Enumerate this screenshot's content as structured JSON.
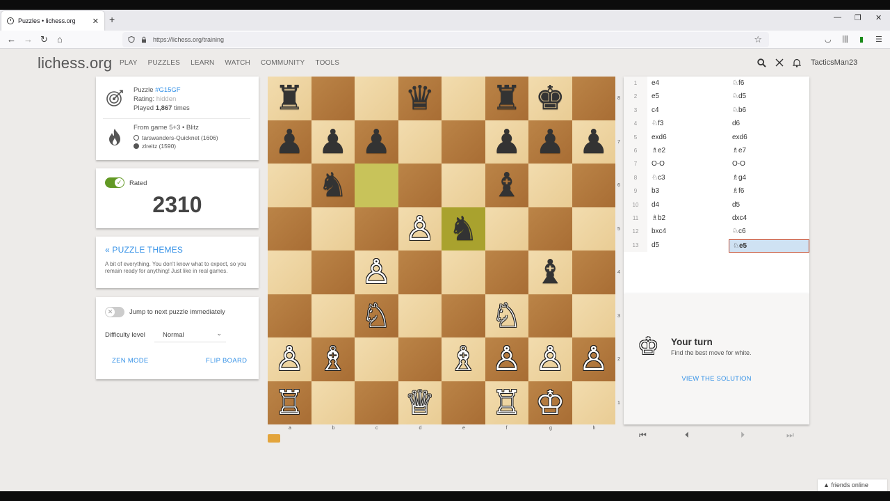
{
  "browser": {
    "tab_title": "Puzzles • lichess.org",
    "tab_close": "✕",
    "new_tab": "+",
    "url": "https://lichess.org/training",
    "win_min": "—",
    "win_max": "❐",
    "win_close": "✕"
  },
  "site": {
    "logo": "lichess.org",
    "nav": [
      "PLAY",
      "PUZZLES",
      "LEARN",
      "WATCH",
      "COMMUNITY",
      "TOOLS"
    ],
    "username": "TacticsMan23"
  },
  "puzzle": {
    "label": "Puzzle ",
    "id": "#G15GF",
    "rating_label": "Rating: ",
    "rating_value": "hidden",
    "played_prefix": "Played ",
    "played_count": "1,867",
    "played_suffix": " times",
    "from_game": "From game 5+3 • Blitz",
    "white_player": "tarswanders-Quicknet (1606)",
    "black_player": "zlreitz (1590)"
  },
  "rating_box": {
    "label": "Rated",
    "value": "2310"
  },
  "themes": {
    "title": "« PUZZLE THEMES",
    "description": "A bit of everything. You don't know what to expect, so you remain ready for anything! Just like in real games."
  },
  "settings": {
    "jump_label": "Jump to next puzzle immediately",
    "difficulty_label": "Difficulty level",
    "difficulty_value": "Normal",
    "zen_mode": "ZEN MODE",
    "flip_board": "FLIP BOARD"
  },
  "board": {
    "ranks": [
      "8",
      "7",
      "6",
      "5",
      "4",
      "3",
      "2",
      "1"
    ],
    "files": [
      "a",
      "b",
      "c",
      "d",
      "e",
      "f",
      "g",
      "h"
    ],
    "highlight_squares": [
      "c6",
      "e5"
    ],
    "pieces": [
      {
        "sq": "a8",
        "glyph": "♜",
        "color": "b",
        "name": "black-rook"
      },
      {
        "sq": "d8",
        "glyph": "♛",
        "color": "b",
        "name": "black-queen"
      },
      {
        "sq": "f8",
        "glyph": "♜",
        "color": "b",
        "name": "black-rook"
      },
      {
        "sq": "g8",
        "glyph": "♚",
        "color": "b",
        "name": "black-king"
      },
      {
        "sq": "a7",
        "glyph": "♟",
        "color": "b",
        "name": "black-pawn"
      },
      {
        "sq": "b7",
        "glyph": "♟",
        "color": "b",
        "name": "black-pawn"
      },
      {
        "sq": "c7",
        "glyph": "♟",
        "color": "b",
        "name": "black-pawn"
      },
      {
        "sq": "f7",
        "glyph": "♟",
        "color": "b",
        "name": "black-pawn"
      },
      {
        "sq": "g7",
        "glyph": "♟",
        "color": "b",
        "name": "black-pawn"
      },
      {
        "sq": "h7",
        "glyph": "♟",
        "color": "b",
        "name": "black-pawn"
      },
      {
        "sq": "b6",
        "glyph": "♞",
        "color": "b",
        "name": "black-knight"
      },
      {
        "sq": "f6",
        "glyph": "♝",
        "color": "b",
        "name": "black-bishop"
      },
      {
        "sq": "d5",
        "glyph": "♙",
        "color": "w",
        "name": "white-pawn"
      },
      {
        "sq": "e5",
        "glyph": "♞",
        "color": "b",
        "name": "black-knight"
      },
      {
        "sq": "c4",
        "glyph": "♙",
        "color": "w",
        "name": "white-pawn"
      },
      {
        "sq": "g4",
        "glyph": "♝",
        "color": "b",
        "name": "black-bishop"
      },
      {
        "sq": "c3",
        "glyph": "♘",
        "color": "w",
        "name": "white-knight"
      },
      {
        "sq": "f3",
        "glyph": "♘",
        "color": "w",
        "name": "white-knight"
      },
      {
        "sq": "a2",
        "glyph": "♙",
        "color": "w",
        "name": "white-pawn"
      },
      {
        "sq": "b2",
        "glyph": "♗",
        "color": "w",
        "name": "white-bishop"
      },
      {
        "sq": "e2",
        "glyph": "♗",
        "color": "w",
        "name": "white-bishop"
      },
      {
        "sq": "f2",
        "glyph": "♙",
        "color": "w",
        "name": "white-pawn"
      },
      {
        "sq": "g2",
        "glyph": "♙",
        "color": "w",
        "name": "white-pawn"
      },
      {
        "sq": "h2",
        "glyph": "♙",
        "color": "w",
        "name": "white-pawn"
      },
      {
        "sq": "a1",
        "glyph": "♖",
        "color": "w",
        "name": "white-rook"
      },
      {
        "sq": "d1",
        "glyph": "♕",
        "color": "w",
        "name": "white-queen"
      },
      {
        "sq": "f1",
        "glyph": "♖",
        "color": "w",
        "name": "white-rook"
      },
      {
        "sq": "g1",
        "glyph": "♔",
        "color": "w",
        "name": "white-king"
      }
    ]
  },
  "moves": [
    {
      "n": "1",
      "w": "e4",
      "b": "♘f6"
    },
    {
      "n": "2",
      "w": "e5",
      "b": "♘d5"
    },
    {
      "n": "3",
      "w": "c4",
      "b": "♘b6"
    },
    {
      "n": "4",
      "w": "♘f3",
      "b": "d6"
    },
    {
      "n": "5",
      "w": "exd6",
      "b": "exd6"
    },
    {
      "n": "6",
      "w": "♗e2",
      "b": "♗e7"
    },
    {
      "n": "7",
      "w": "O-O",
      "b": "O-O"
    },
    {
      "n": "8",
      "w": "♘c3",
      "b": "♗g4"
    },
    {
      "n": "9",
      "w": "b3",
      "b": "♗f6"
    },
    {
      "n": "10",
      "w": "d4",
      "b": "d5"
    },
    {
      "n": "11",
      "w": "♗b2",
      "b": "dxc4"
    },
    {
      "n": "12",
      "w": "bxc4",
      "b": "♘c6"
    },
    {
      "n": "13",
      "w": "d5",
      "b": "♘e5"
    }
  ],
  "turn": {
    "title": "Your turn",
    "subtitle": "Find the best move for white.",
    "view_solution": "VIEW THE SOLUTION"
  },
  "controls": {
    "first": "⏮",
    "prev": "⏴",
    "next": "⏵",
    "last": "⏭"
  },
  "footer": {
    "friends": "▲ friends online"
  }
}
